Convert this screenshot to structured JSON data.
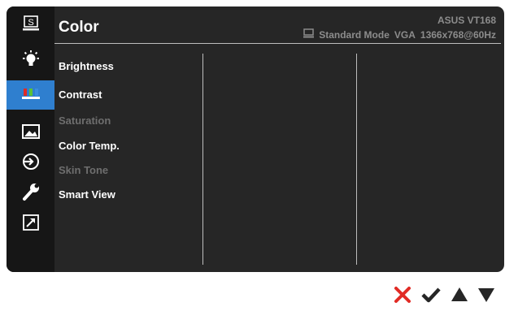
{
  "header": {
    "title": "Color",
    "model": "ASUS VT168",
    "mode": "Standard Mode",
    "input": "VGA",
    "resolution": "1366x768@60Hz"
  },
  "sidebar": {
    "items": [
      {
        "name": "splendid",
        "icon": "splendid-icon",
        "active": false
      },
      {
        "name": "brightness",
        "icon": "lightbulb-icon",
        "active": false
      },
      {
        "name": "color",
        "icon": "color-bars-icon",
        "active": true
      },
      {
        "name": "image",
        "icon": "image-icon",
        "active": false
      },
      {
        "name": "input-select",
        "icon": "input-icon",
        "active": false
      },
      {
        "name": "system-setup",
        "icon": "wrench-icon",
        "active": false
      },
      {
        "name": "shortcut",
        "icon": "shortcut-icon",
        "active": false
      }
    ]
  },
  "menu": {
    "items": [
      {
        "label": "Brightness",
        "enabled": true
      },
      {
        "label": "Contrast",
        "enabled": true
      },
      {
        "label": "Saturation",
        "enabled": false
      },
      {
        "label": "Color Temp.",
        "enabled": true
      },
      {
        "label": "Skin Tone",
        "enabled": false
      },
      {
        "label": "Smart View",
        "enabled": true
      }
    ]
  },
  "controls": [
    "close-icon",
    "confirm-icon",
    "up-arrow-icon",
    "down-arrow-icon"
  ],
  "colors": {
    "background": "#262626",
    "sidebar": "#161616",
    "active": "#2f7fcf",
    "close": "#e12b25",
    "text": "#ffffff",
    "disabled": "#6e6e6e",
    "header_info": "#8c8c8c"
  }
}
